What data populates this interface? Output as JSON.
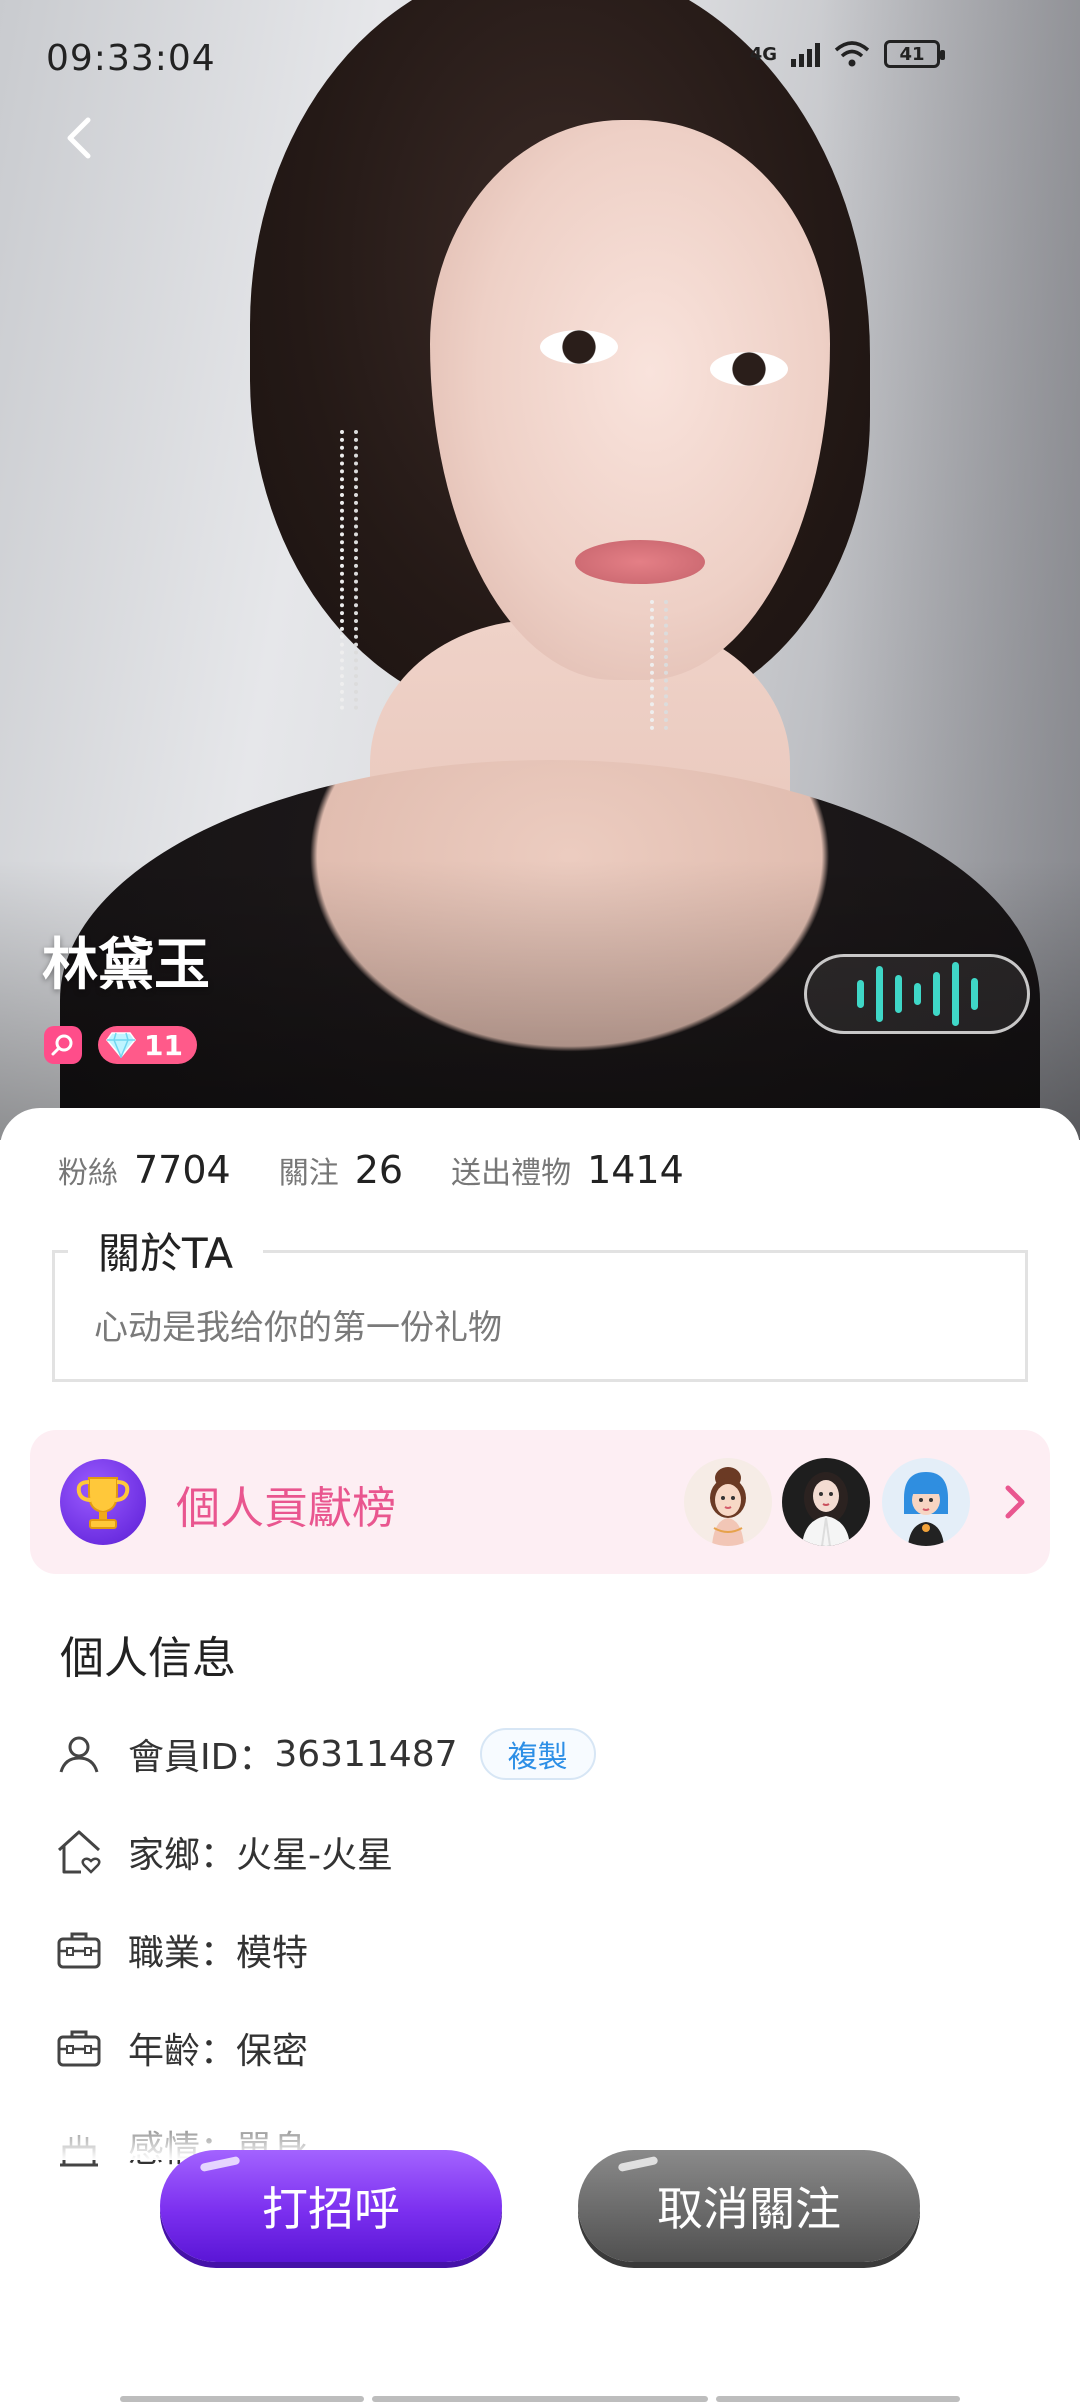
{
  "status_bar": {
    "time": "09:33:04",
    "network": "4G",
    "battery": "41"
  },
  "profile": {
    "name": "林黛玉",
    "level": "11"
  },
  "stats": [
    {
      "label": "粉絲",
      "value": "7704"
    },
    {
      "label": "關注",
      "value": "26"
    },
    {
      "label": "送出禮物",
      "value": "1414"
    }
  ],
  "about": {
    "title": "關於TA",
    "text": "心动是我给你的第一份礼物"
  },
  "ranking": {
    "title": "個人貢獻榜"
  },
  "personal_info": {
    "title": "個人信息",
    "member_id_label": "會員ID：",
    "member_id": "36311487",
    "copy_label": "複製",
    "hometown_label": "家鄉：",
    "hometown": "火星-火星",
    "job_label": "職業：",
    "job": "模特",
    "age_label": "年齡：",
    "age": "保密",
    "relationship_label": "感情：",
    "relationship": "單身"
  },
  "actions": {
    "greet": "打招呼",
    "unfollow": "取消關注"
  },
  "colors": {
    "accent_pink": "#e9568f",
    "purple": "#7b2fef",
    "voice_teal": "#3fd7c7",
    "copy_blue": "#2d8fe6"
  }
}
